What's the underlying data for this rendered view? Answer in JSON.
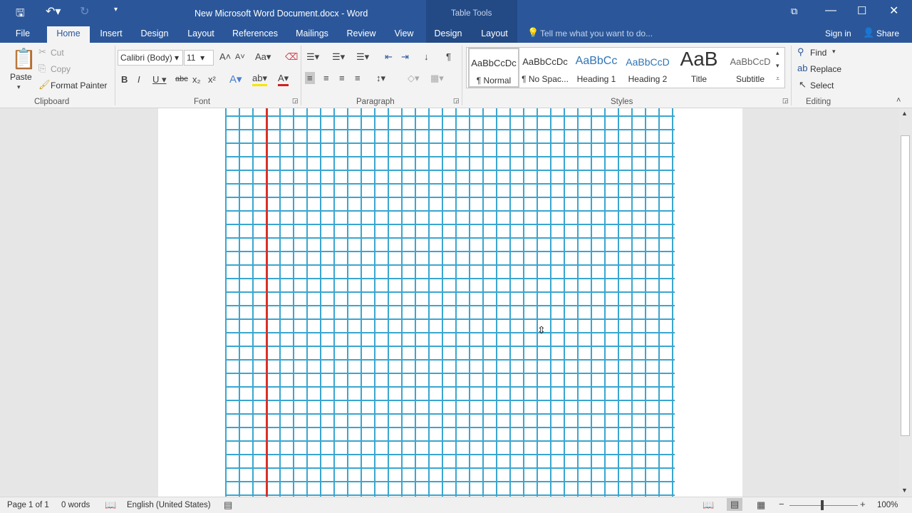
{
  "title": "New Microsoft Word Document.docx - Word",
  "table_tools": "Table Tools",
  "tabs": [
    "File",
    "Home",
    "Insert",
    "Design",
    "Layout",
    "References",
    "Mailings",
    "Review",
    "View",
    "Design",
    "Layout"
  ],
  "tell_me": "Tell me what you want to do...",
  "sign_in": "Sign in",
  "share": "Share",
  "clipboard": {
    "paste": "Paste",
    "cut": "Cut",
    "copy": "Copy",
    "format_painter": "Format Painter",
    "label": "Clipboard"
  },
  "font": {
    "name": "Calibri (Body)",
    "size": "11",
    "label": "Font"
  },
  "paragraph": {
    "label": "Paragraph"
  },
  "styles": {
    "label": "Styles",
    "items": [
      {
        "preview": "AaBbCcDc",
        "name": "¶ Normal"
      },
      {
        "preview": "AaBbCcDc",
        "name": "¶ No Spac..."
      },
      {
        "preview": "AaBbCc",
        "name": "Heading 1"
      },
      {
        "preview": "AaBbCcD",
        "name": "Heading 2"
      },
      {
        "preview": "AaB",
        "name": "Title"
      },
      {
        "preview": "AaBbCcD",
        "name": "Subtitle"
      }
    ]
  },
  "editing": {
    "find": "Find",
    "replace": "Replace",
    "select": "Select",
    "label": "Editing"
  },
  "status": {
    "page": "Page 1 of 1",
    "words": "0 words",
    "language": "English (United States)",
    "zoom": "100%"
  },
  "colors": {
    "accent": "#2b579a",
    "grid": "#3aa6d0",
    "margin_line": "#d9302a"
  }
}
